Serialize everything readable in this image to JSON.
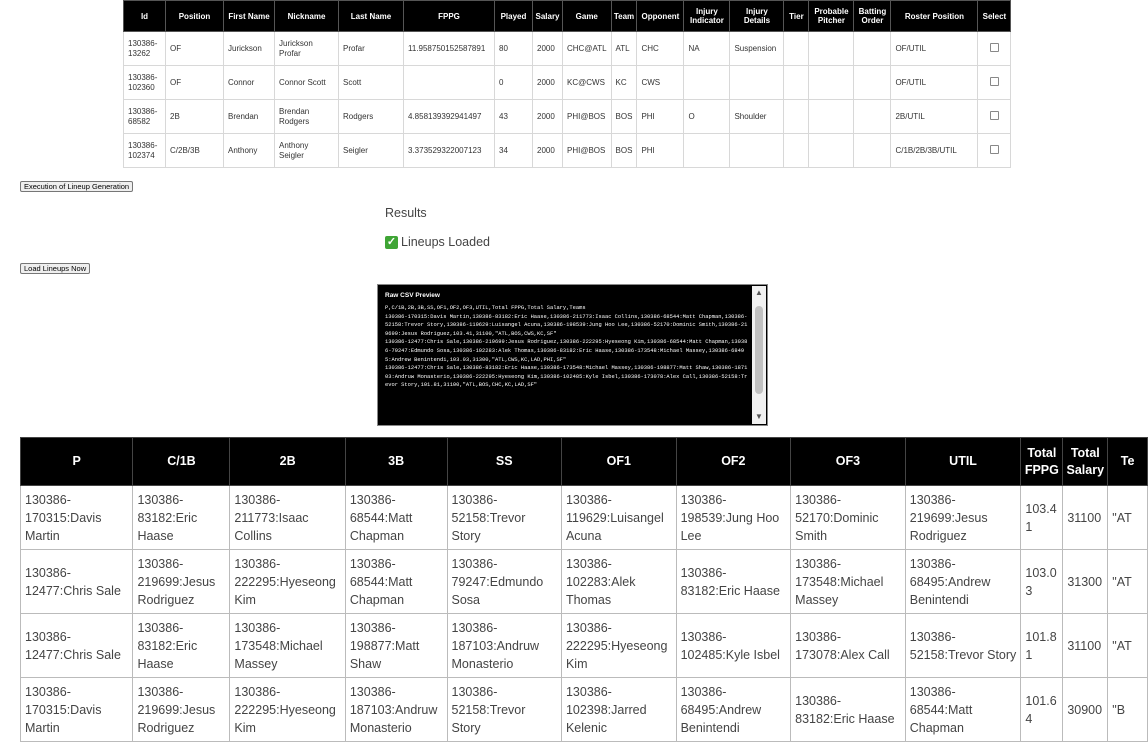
{
  "players_table": {
    "headers": [
      "Id",
      "Position",
      "First Name",
      "Nickname",
      "Last Name",
      "FPPG",
      "Played",
      "Salary",
      "Game",
      "Team",
      "Opponent",
      "Injury Indicator",
      "Injury Details",
      "Tier",
      "Probable Pitcher",
      "Batting Order",
      "Roster Position",
      "Select"
    ],
    "rows": [
      [
        "130386-13262",
        "OF",
        "Jurickson",
        "Jurickson Profar",
        "Profar",
        "11.958750152587891",
        "80",
        "2000",
        "CHC@ATL",
        "ATL",
        "CHC",
        "NA",
        "Suspension",
        "",
        "",
        "",
        "OF/UTIL"
      ],
      [
        "130386-102360",
        "OF",
        "Connor",
        "Connor Scott",
        "Scott",
        "",
        "0",
        "2000",
        "KC@CWS",
        "KC",
        "CWS",
        "",
        "",
        "",
        "",
        "",
        "OF/UTIL"
      ],
      [
        "130386-68582",
        "2B",
        "Brendan",
        "Brendan Rodgers",
        "Rodgers",
        "4.858139392941497",
        "43",
        "2000",
        "PHI@BOS",
        "BOS",
        "PHI",
        "O",
        "Shoulder",
        "",
        "",
        "",
        "2B/UTIL"
      ],
      [
        "130386-102374",
        "C/2B/3B",
        "Anthony",
        "Anthony Seigler",
        "Seigler",
        "3.373529322007123",
        "34",
        "2000",
        "PHI@BOS",
        "BOS",
        "PHI",
        "",
        "",
        "",
        "",
        "",
        "C/1B/2B/3B/UTIL"
      ]
    ]
  },
  "buttons": {
    "execution": "Execution of Lineup Generation",
    "load": "Load Lineups Now"
  },
  "results": {
    "title": "Results",
    "status": "Lineups Loaded"
  },
  "csv_preview": {
    "label": "Raw CSV Preview",
    "text": "P,C/1B,2B,3B,SS,OF1,OF2,OF3,UTIL,Total FPPG,Total Salary,Teams\n130386-170315:Davis Martin,130386-83182:Eric Haase,130386-211773:Isaac Collins,130386-68544:Matt Chapman,130386-52158:Trevor Story,130386-119629:Luisangel Acuna,130386-198539:Jung Hoo Lee,130386-52170:Dominic Smith,130386-219699:Jesus Rodriguez,103.41,31100,\"ATL,BOS,CWS,KC,SF\"\n130386-12477:Chris Sale,130386-219699:Jesus Rodriguez,130386-222295:Hyeseong Kim,130386-68544:Matt Chapman,130386-79247:Edmundo Sosa,130386-102283:Alek Thomas,130386-83182:Eric Haase,130386-173548:Michael Massey,130386-68495:Andrew Benintendi,103.03,31300,\"ATL,CWS,KC,LAD,PHI,SF\"\n130386-12477:Chris Sale,130386-83182:Eric Haase,130386-173548:Michael Massey,130386-198877:Matt Shaw,130386-187103:Andruw Monasterio,130386-222295:Hyeseong Kim,130386-102485:Kyle Isbel,130386-173078:Alex Call,130386-52158:Trevor Story,101.81,31100,\"ATL,BOS,CHC,KC,LAD,SF\""
  },
  "lineups_table": {
    "headers": [
      "P",
      "C/1B",
      "2B",
      "3B",
      "SS",
      "OF1",
      "OF2",
      "OF3",
      "UTIL",
      "Total FPPG",
      "Total Salary",
      "Te"
    ],
    "rows": [
      [
        "130386-170315:Davis Martin",
        "130386-83182:Eric Haase",
        "130386-211773:Isaac Collins",
        "130386-68544:Matt Chapman",
        "130386-52158:Trevor Story",
        "130386-119629:Luisangel Acuna",
        "130386-198539:Jung Hoo Lee",
        "130386-52170:Dominic Smith",
        "130386-219699:Jesus Rodriguez",
        "103.41",
        "31100",
        "\"AT"
      ],
      [
        "130386-12477:Chris Sale",
        "130386-219699:Jesus Rodriguez",
        "130386-222295:Hyeseong Kim",
        "130386-68544:Matt Chapman",
        "130386-79247:Edmundo Sosa",
        "130386-102283:Alek Thomas",
        "130386-83182:Eric Haase",
        "130386-173548:Michael Massey",
        "130386-68495:Andrew Benintendi",
        "103.03",
        "31300",
        "\"AT"
      ],
      [
        "130386-12477:Chris Sale",
        "130386-83182:Eric Haase",
        "130386-173548:Michael Massey",
        "130386-198877:Matt Shaw",
        "130386-187103:Andruw Monasterio",
        "130386-222295:Hyeseong Kim",
        "130386-102485:Kyle Isbel",
        "130386-173078:Alex Call",
        "130386-52158:Trevor Story",
        "101.81",
        "31100",
        "\"AT"
      ],
      [
        "130386-170315:Davis Martin",
        "130386-219699:Jesus Rodriguez",
        "130386-222295:Hyeseong Kim",
        "130386-187103:Andruw Monasterio",
        "130386-52158:Trevor Story",
        "130386-102398:Jarred Kelenic",
        "130386-68495:Andrew Benintendi",
        "130386-83182:Eric Haase",
        "130386-68544:Matt Chapman",
        "101.64",
        "30900",
        "\"B"
      ]
    ]
  },
  "colors": {
    "header_bg": "#000000",
    "header_text": "#ffffff",
    "check_green": "#3fa535"
  }
}
